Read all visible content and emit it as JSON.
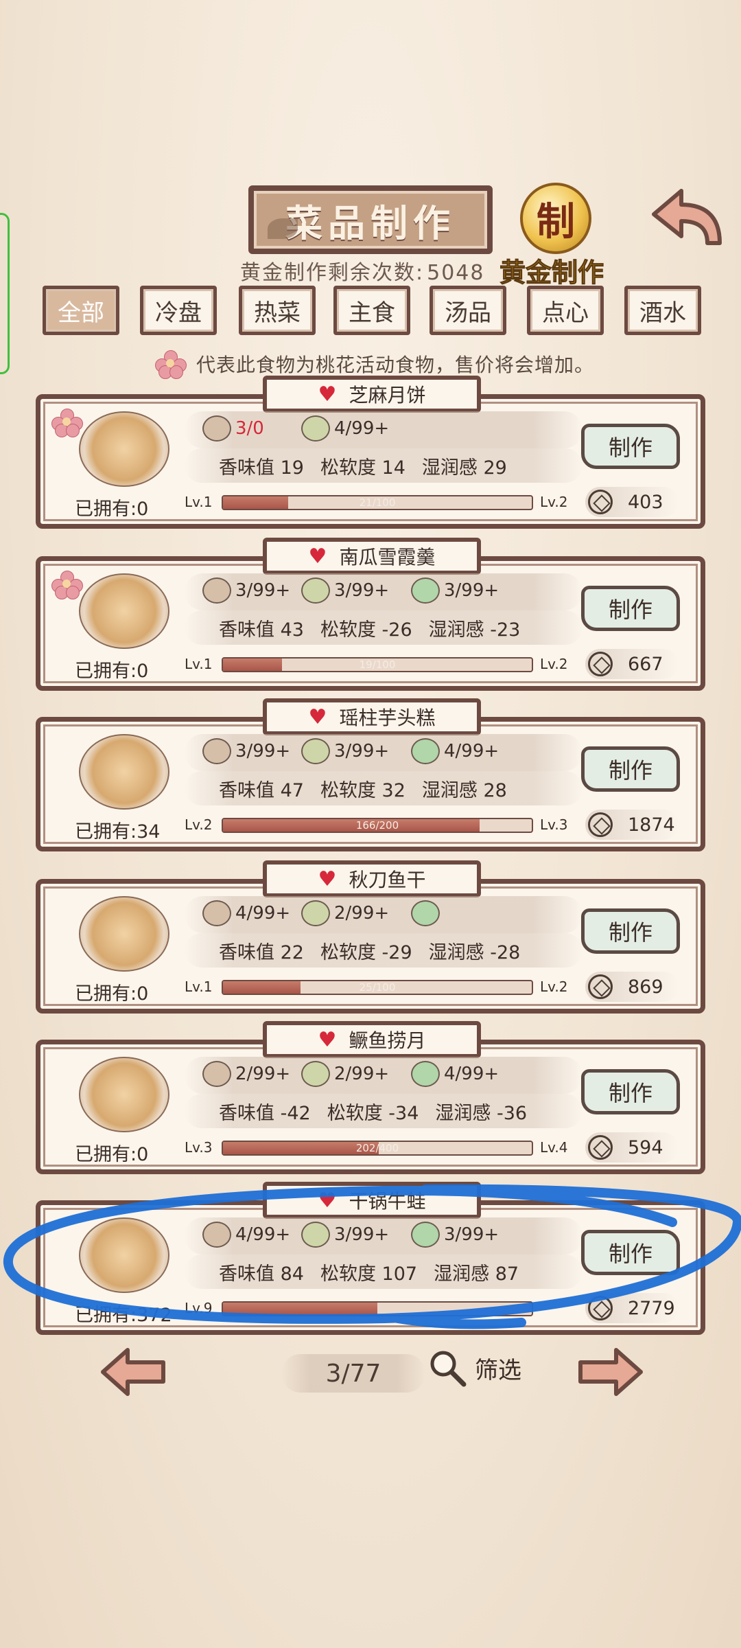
{
  "header": {
    "title": "菜品制作",
    "gold_badge_char": "制",
    "gold_label": "黄金制作",
    "remaining_label": "黄金制作剩余次数:",
    "remaining_value": "5048"
  },
  "tabs": [
    {
      "label": "全部",
      "active": true
    },
    {
      "label": "冷盘",
      "active": false
    },
    {
      "label": "热菜",
      "active": false
    },
    {
      "label": "主食",
      "active": false
    },
    {
      "label": "汤品",
      "active": false
    },
    {
      "label": "点心",
      "active": false
    },
    {
      "label": "酒水",
      "active": false
    }
  ],
  "notice": "代表此食物为桃花活动食物，售价将会增加。",
  "recipes": [
    {
      "name": "芝麻月饼",
      "peach": true,
      "ingredients": [
        {
          "icon": "flour-bowl-icon",
          "count": "3/0",
          "short": true
        },
        {
          "icon": "black-sesame-icon",
          "count": "4/99+",
          "short": false
        }
      ],
      "stats": {
        "aroma_label": "香味值",
        "aroma": "19",
        "soft_label": "松软度",
        "soft": "14",
        "moist_label": "湿润感",
        "moist": "29"
      },
      "owned_label": "已拥有:",
      "owned": "0",
      "lv_from": "Lv.1",
      "lv_to": "Lv.2",
      "progress_text": "21/100",
      "progress": 0.21,
      "make_label": "制作",
      "price": "403"
    },
    {
      "name": "南瓜雪霞羹",
      "peach": true,
      "ingredients": [
        {
          "icon": "rose-icon",
          "count": "3/99+"
        },
        {
          "icon": "tofu-icon",
          "count": "3/99+"
        },
        {
          "icon": "pumpkin-icon",
          "count": "3/99+"
        }
      ],
      "stats": {
        "aroma_label": "香味值",
        "aroma": "43",
        "soft_label": "松软度",
        "soft": "-26",
        "moist_label": "湿润感",
        "moist": "-23"
      },
      "owned_label": "已拥有:",
      "owned": "0",
      "lv_from": "Lv.1",
      "lv_to": "Lv.2",
      "progress_text": "19/100",
      "progress": 0.19,
      "make_label": "制作",
      "price": "667"
    },
    {
      "name": "瑶柱芋头糕",
      "peach": false,
      "ingredients": [
        {
          "icon": "taro-icon",
          "count": "3/99+"
        },
        {
          "icon": "scallop-icon",
          "count": "3/99+"
        },
        {
          "icon": "rice-flour-icon",
          "count": "4/99+"
        }
      ],
      "stats": {
        "aroma_label": "香味值",
        "aroma": "47",
        "soft_label": "松软度",
        "soft": "32",
        "moist_label": "湿润感",
        "moist": "28"
      },
      "owned_label": "已拥有:",
      "owned": "34",
      "lv_from": "Lv.2",
      "lv_to": "Lv.3",
      "progress_text": "166/200",
      "progress": 0.83,
      "make_label": "制作",
      "price": "1874"
    },
    {
      "name": "秋刀鱼干",
      "peach": false,
      "ingredients": [
        {
          "icon": "saury-icon",
          "count": "4/99+"
        },
        {
          "icon": "wine-jar-icon",
          "count": "2/99+"
        },
        {
          "icon": "salt-plate-icon",
          "count": ""
        }
      ],
      "stats": {
        "aroma_label": "香味值",
        "aroma": "22",
        "soft_label": "松软度",
        "soft": "-29",
        "moist_label": "湿润感",
        "moist": "-28"
      },
      "owned_label": "已拥有:",
      "owned": "0",
      "lv_from": "Lv.1",
      "lv_to": "Lv.2",
      "progress_text": "25/100",
      "progress": 0.25,
      "make_label": "制作",
      "price": "869"
    },
    {
      "name": "鳜鱼捞月",
      "peach": false,
      "ingredients": [
        {
          "icon": "mandarin-fish-icon",
          "count": "2/99+"
        },
        {
          "icon": "egg-icon",
          "count": "2/99+"
        },
        {
          "icon": "broth-bowl-icon",
          "count": "4/99+"
        }
      ],
      "stats": {
        "aroma_label": "香味值",
        "aroma": "-42",
        "soft_label": "松软度",
        "soft": "-34",
        "moist_label": "湿润感",
        "moist": "-36"
      },
      "owned_label": "已拥有:",
      "owned": "0",
      "lv_from": "Lv.3",
      "lv_to": "Lv.4",
      "progress_text": "202/400",
      "progress": 0.505,
      "make_label": "制作",
      "price": "594"
    },
    {
      "name": "干锅牛蛙",
      "peach": false,
      "ingredients": [
        {
          "icon": "lime-icon",
          "count": "4/99+"
        },
        {
          "icon": "chili-icon",
          "count": "3/99+"
        },
        {
          "icon": "butter-icon",
          "count": "3/99+"
        }
      ],
      "stats": {
        "aroma_label": "香味值",
        "aroma": "84",
        "soft_label": "松软度",
        "soft": "107",
        "moist_label": "湿润感",
        "moist": "87"
      },
      "owned_label": "已拥有:",
      "owned": "372",
      "lv_from": "Lv.9",
      "lv_to": "",
      "progress_text": "",
      "progress": 0.5,
      "make_label": "制作",
      "price": "2779"
    }
  ],
  "pager": {
    "page": "3/77",
    "filter_label": "筛选"
  },
  "colors": {
    "frame": "#6d4a41",
    "heart": "#d6283a",
    "gold": "#f0c34f",
    "scribble": "#1f6fd6"
  }
}
